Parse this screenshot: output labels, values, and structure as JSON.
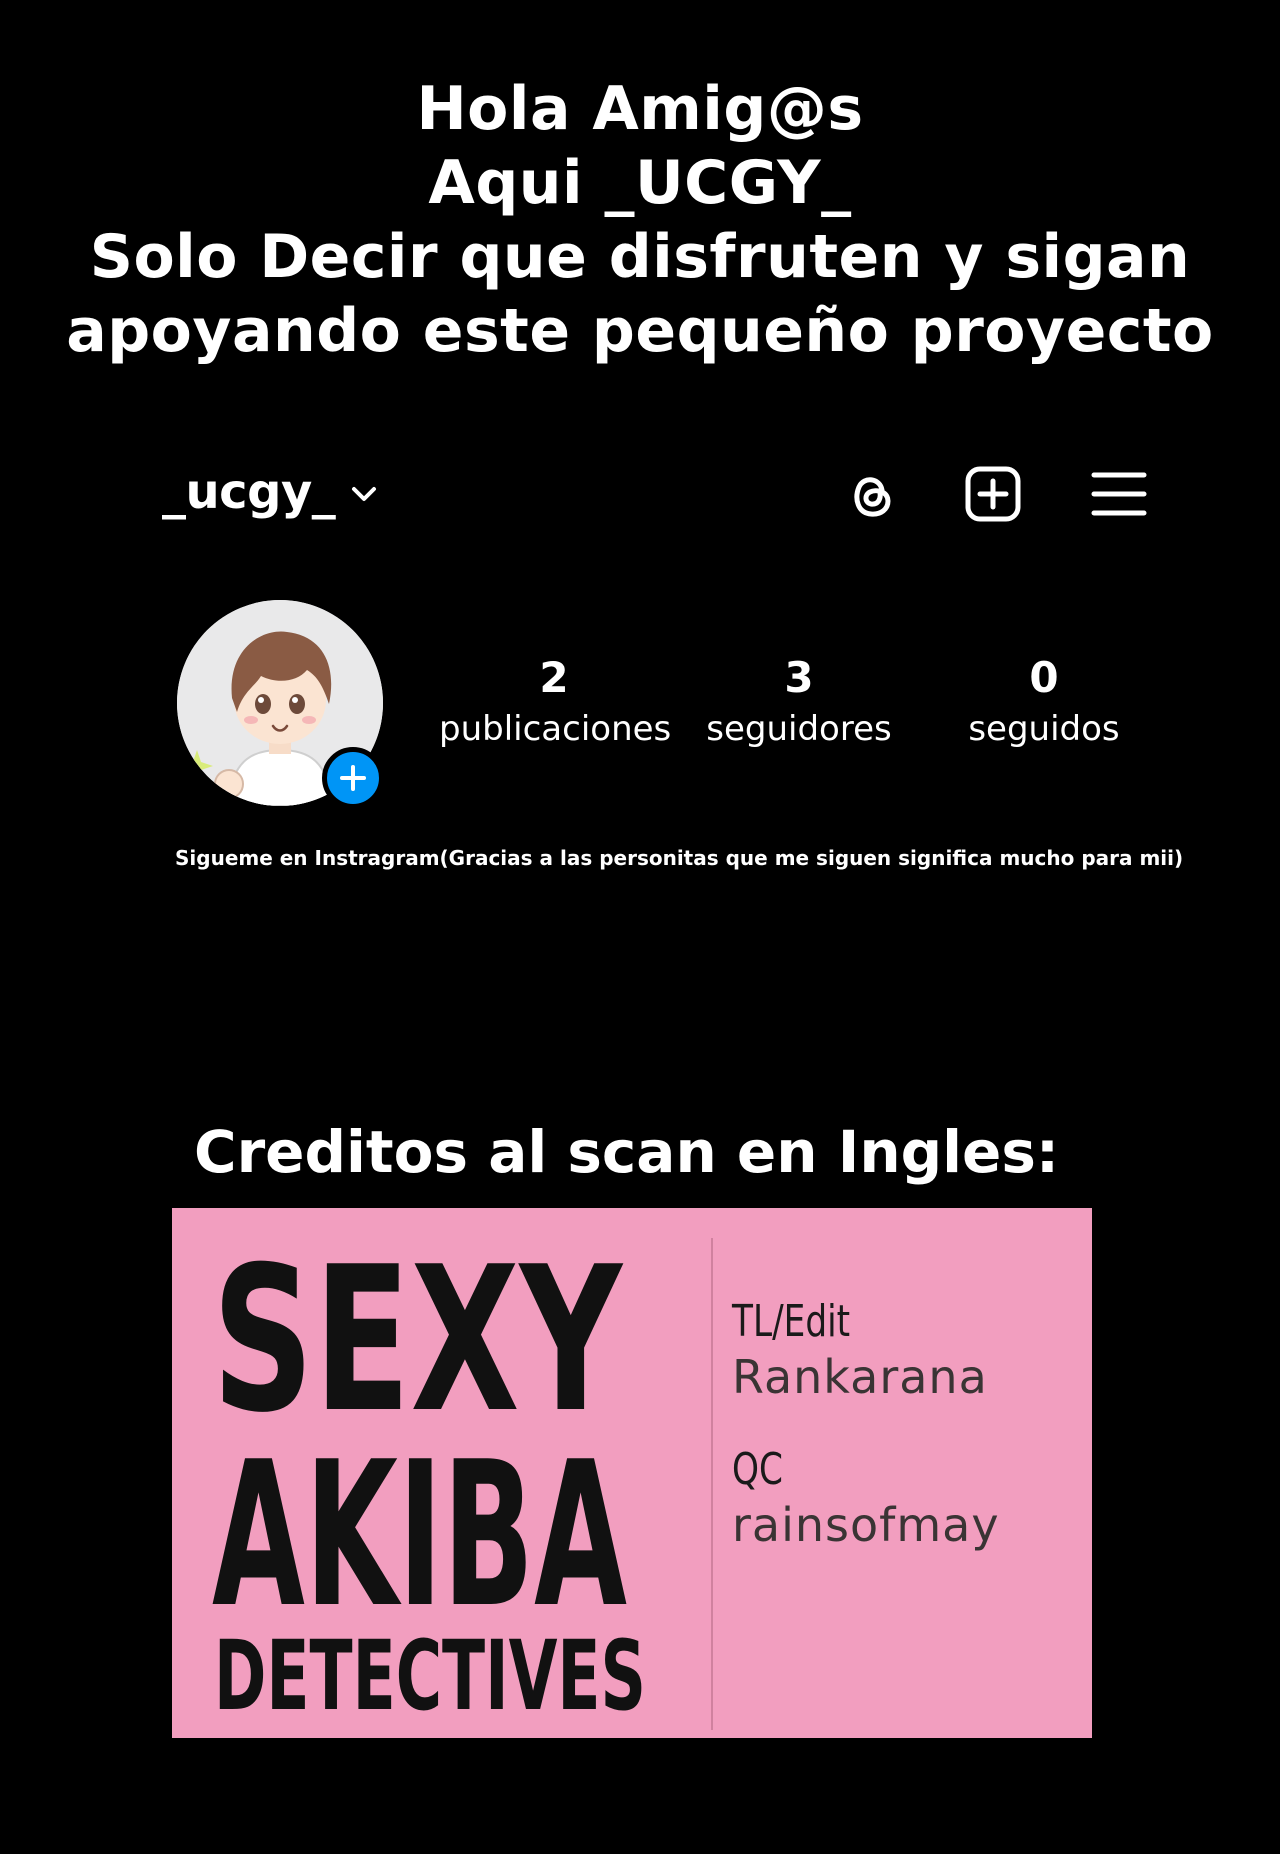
{
  "intro": {
    "lines": [
      "Hola Amig@s",
      "Aqui _UCGY_",
      "Solo Decir que disfruten y sigan",
      "apoyando este pequeño proyecto"
    ]
  },
  "profile": {
    "username": "_ucgy_",
    "header_icons": [
      "chevron-down-icon",
      "threads-icon",
      "new-post-icon",
      "hamburger-menu-icon"
    ],
    "stats": {
      "posts": {
        "count": "2",
        "label": "publicaciones"
      },
      "followers": {
        "count": "3",
        "label": "seguidores"
      },
      "following": {
        "count": "0",
        "label": "seguidos"
      }
    },
    "bio": "Sigueme en Instragram(Gracias a las personitas que me siguen significa mucho para mii)",
    "avatar_badge_icon": "plus-icon"
  },
  "credits": {
    "title": "Creditos al scan en Ingles:",
    "logo": {
      "line1": "SEXY",
      "line2": "AKIBA",
      "line3": "DETECTIVES"
    },
    "roles": [
      {
        "role": "TL/Edit",
        "name": "Rankarana"
      },
      {
        "role": "QC",
        "name": "rainsofmay"
      }
    ]
  },
  "colors": {
    "background": "#000000",
    "text": "#ffffff",
    "accent_blue": "#0095f6",
    "card_pink": "#f29ebf"
  }
}
